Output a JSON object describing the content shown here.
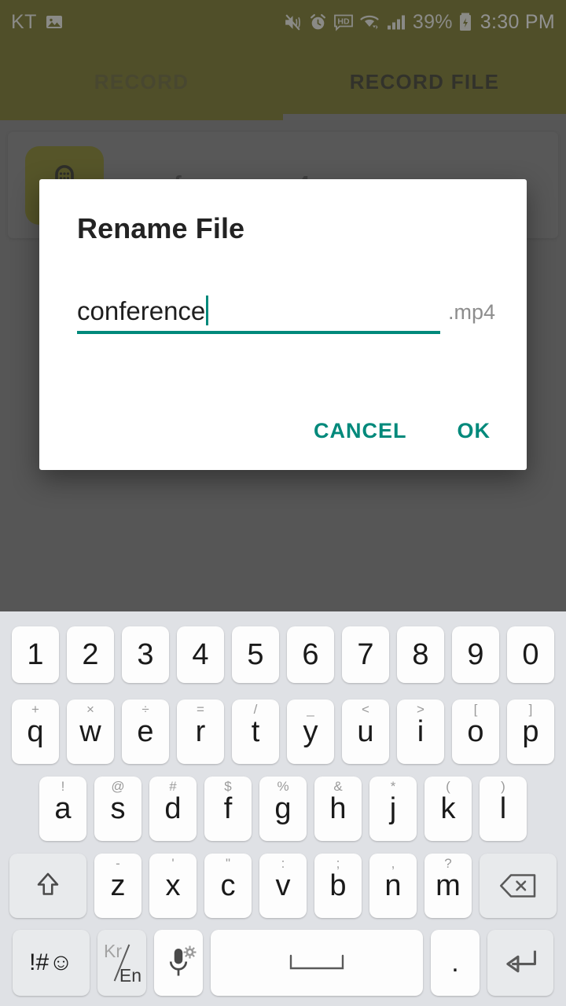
{
  "status_bar": {
    "carrier": "KT",
    "icons": [
      "image-icon",
      "mute-vibrate-icon",
      "alarm-icon",
      "hd-icon",
      "wifi-icon",
      "signal-icon"
    ],
    "battery_percent": "39%",
    "battery_icon": "battery-charging-icon",
    "time": "3:30 PM"
  },
  "tabs": {
    "items": [
      {
        "label": "RECORD",
        "active": false
      },
      {
        "label": "RECORD FILE",
        "active": true
      }
    ]
  },
  "file_list": {
    "items": [
      {
        "name": "conference.mp4",
        "thumb_icon": "microphone-icon"
      }
    ]
  },
  "dialog": {
    "title": "Rename File",
    "input_value": "conference",
    "input_placeholder": "",
    "extension": ".mp4",
    "cancel_label": "CANCEL",
    "ok_label": "OK"
  },
  "colors": {
    "accent_teal": "#00897b",
    "app_bar_olive": "#5e5b07",
    "scrim_gray": "#6a6a6a",
    "keyboard_bg": "#dfe1e5",
    "key_face": "#fdfdfd",
    "key_fn_face": "#e8eaec"
  },
  "keyboard": {
    "rows": {
      "numbers": [
        {
          "main": "1"
        },
        {
          "main": "2"
        },
        {
          "main": "3"
        },
        {
          "main": "4"
        },
        {
          "main": "5"
        },
        {
          "main": "6"
        },
        {
          "main": "7"
        },
        {
          "main": "8"
        },
        {
          "main": "9"
        },
        {
          "main": "0"
        }
      ],
      "top": [
        {
          "main": "q",
          "sub": "+"
        },
        {
          "main": "w",
          "sub": "×"
        },
        {
          "main": "e",
          "sub": "÷"
        },
        {
          "main": "r",
          "sub": "="
        },
        {
          "main": "t",
          "sub": "/"
        },
        {
          "main": "y",
          "sub": "_"
        },
        {
          "main": "u",
          "sub": "<"
        },
        {
          "main": "i",
          "sub": ">"
        },
        {
          "main": "o",
          "sub": "["
        },
        {
          "main": "p",
          "sub": "]"
        }
      ],
      "home": [
        {
          "main": "a",
          "sub": "!"
        },
        {
          "main": "s",
          "sub": "@"
        },
        {
          "main": "d",
          "sub": "#"
        },
        {
          "main": "f",
          "sub": "$"
        },
        {
          "main": "g",
          "sub": "%"
        },
        {
          "main": "h",
          "sub": "&"
        },
        {
          "main": "j",
          "sub": "*"
        },
        {
          "main": "k",
          "sub": "("
        },
        {
          "main": "l",
          "sub": ")"
        }
      ],
      "bottom": [
        {
          "main": "z",
          "sub": "-"
        },
        {
          "main": "x",
          "sub": "'"
        },
        {
          "main": "c",
          "sub": "\""
        },
        {
          "main": "v",
          "sub": ":"
        },
        {
          "main": "b",
          "sub": ";"
        },
        {
          "main": "n",
          "sub": ","
        },
        {
          "main": "m",
          "sub": "?"
        }
      ]
    },
    "shift_key": "shift-icon",
    "backspace_key": "backspace-icon",
    "symbols_key": "!#☺",
    "language_key": {
      "first": "Kr",
      "second": "En"
    },
    "mic_key": "microphone-icon",
    "space_key": "space-icon",
    "period_key": ".",
    "enter_key": "enter-icon"
  }
}
